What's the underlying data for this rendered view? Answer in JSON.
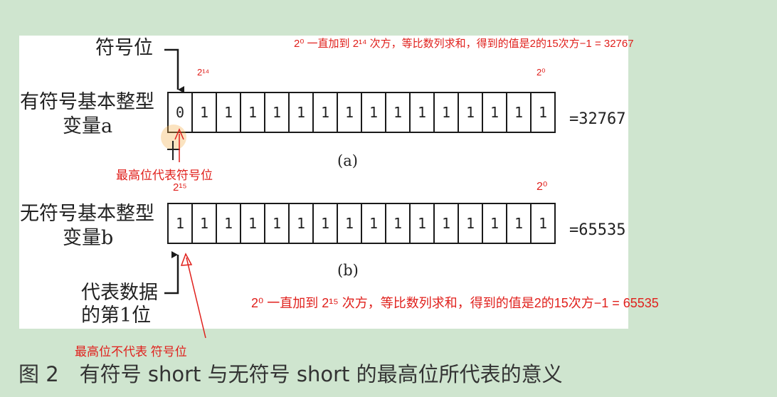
{
  "labels": {
    "sign_bit": "符号位",
    "signed_line1": "有符号基本整型",
    "signed_line2": "变量a",
    "unsigned_line1": "无符号基本整型",
    "unsigned_line2": "变量b",
    "data_first_line1": "代表数据",
    "data_first_line2": "的第1位",
    "cap_a": "(a)",
    "cap_b": "(b)"
  },
  "row_a": {
    "bits": [
      "0",
      "1",
      "1",
      "1",
      "1",
      "1",
      "1",
      "1",
      "1",
      "1",
      "1",
      "1",
      "1",
      "1",
      "1",
      "1"
    ],
    "value": "=32767"
  },
  "row_b": {
    "bits": [
      "1",
      "1",
      "1",
      "1",
      "1",
      "1",
      "1",
      "1",
      "1",
      "1",
      "1",
      "1",
      "1",
      "1",
      "1",
      "1"
    ],
    "value": "=65535"
  },
  "annotations": {
    "top_note": "2⁰ 一直加到 2¹⁴ 次方，等比数列求和，得到的值是2的15次方−1 = 32767",
    "a_left_exp": "2¹⁴",
    "a_right_exp": "2⁰",
    "msb_is_sign": "最高位代表符号位",
    "b_left_exp": "2¹⁵",
    "b_right_exp": "2⁰",
    "bottom_note": "2⁰ 一直加到 2¹⁵ 次方，等比数列求和，得到的值是2的15次方−1 = 65535",
    "msb_not_sign": "最高位不代表 符号位"
  },
  "figure_caption": "图 2　有符号 short 与无符号 short 的最高位所代表的意义",
  "colors": {
    "annotation": "#e0201c",
    "background": "#cfe5cf"
  }
}
